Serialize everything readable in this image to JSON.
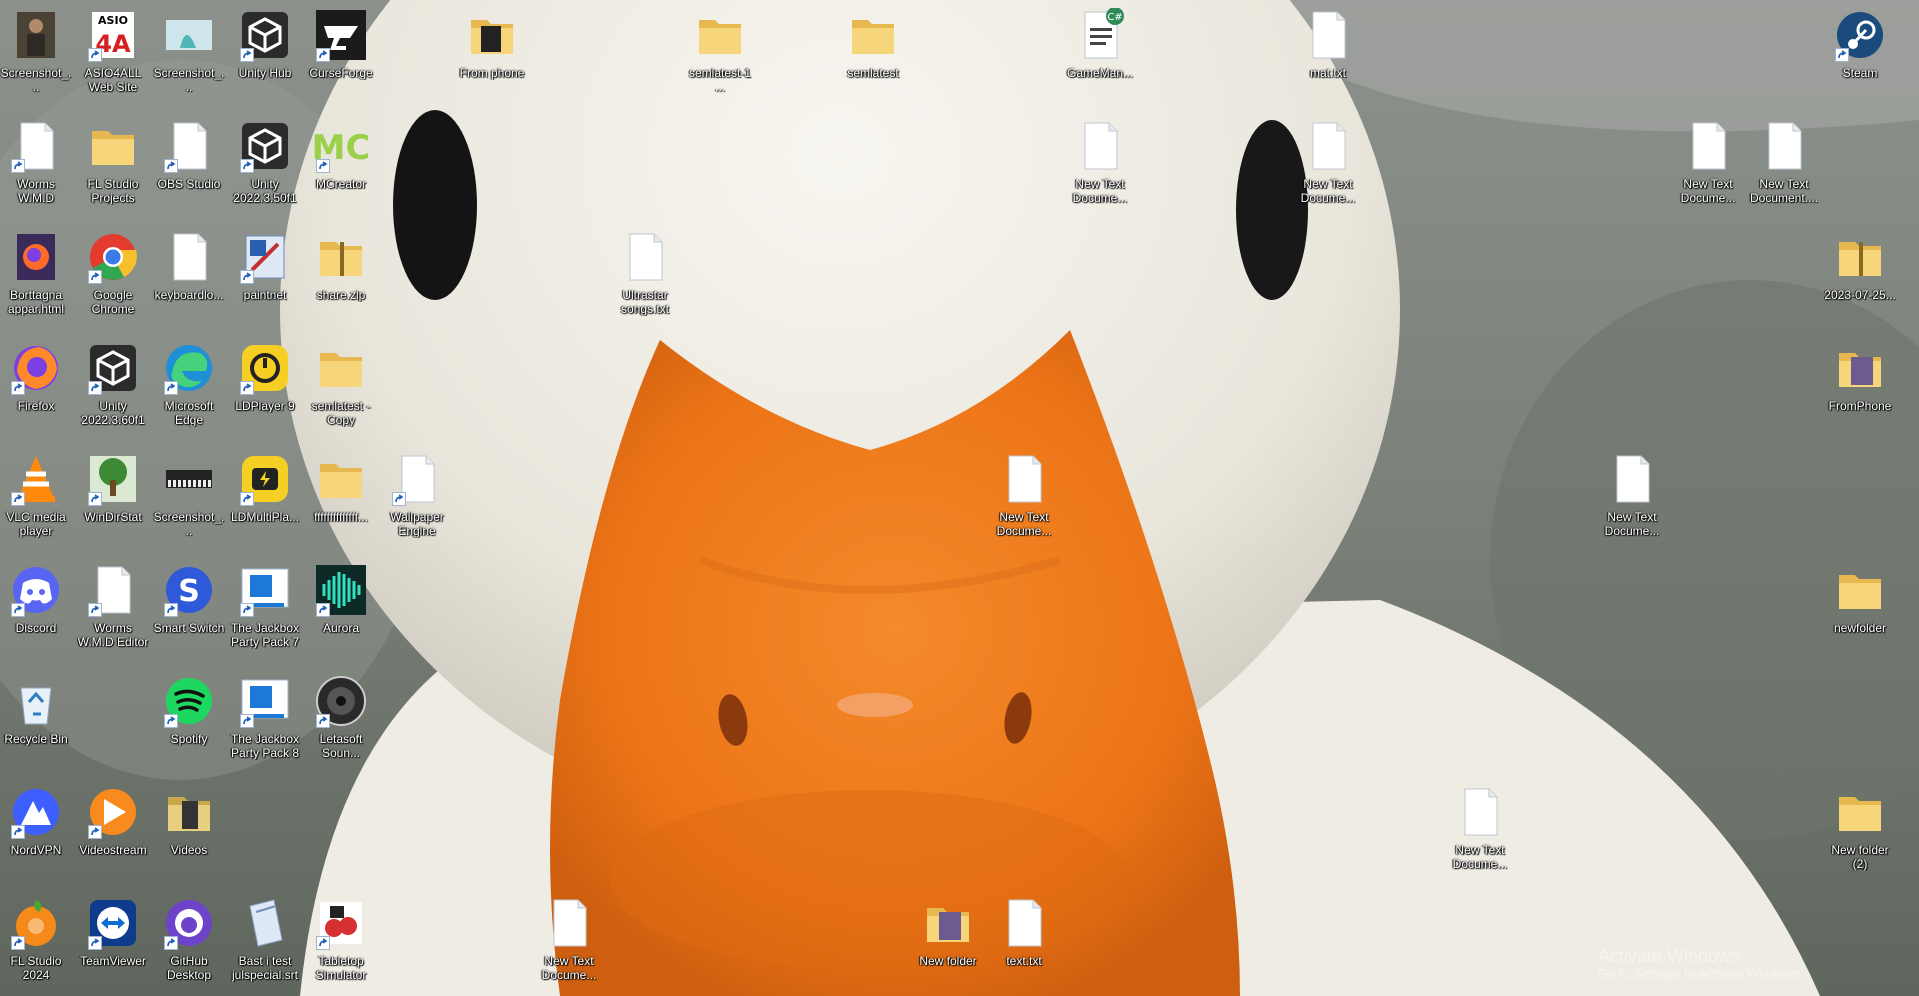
{
  "desktop": {
    "icons": [
      {
        "id": "screenshot-1",
        "label": "Screenshot_...",
        "kind": "photo",
        "shortcut": false
      },
      {
        "id": "asio4all",
        "label": "ASIO4ALL Web Site",
        "kind": "asio",
        "shortcut": true
      },
      {
        "id": "screenshot-2",
        "label": "Screenshot_...",
        "kind": "photo-anime",
        "shortcut": false
      },
      {
        "id": "unity-hub",
        "label": "Unity Hub",
        "kind": "unity",
        "shortcut": true
      },
      {
        "id": "curseforge",
        "label": "CurseForge",
        "kind": "curseforge",
        "shortcut": true
      },
      {
        "id": "from-phone",
        "label": "From phone",
        "kind": "folder-dark",
        "shortcut": false
      },
      {
        "id": "semlatest-1",
        "label": "semlatest-1 ...",
        "kind": "folder",
        "shortcut": false
      },
      {
        "id": "semlatest",
        "label": "semlatest",
        "kind": "folder",
        "shortcut": false
      },
      {
        "id": "gamemanager",
        "label": "GameMan...",
        "kind": "csharp",
        "shortcut": false
      },
      {
        "id": "mat-txt",
        "label": "mat.txt",
        "kind": "text",
        "shortcut": false
      },
      {
        "id": "steam",
        "label": "Steam",
        "kind": "steam",
        "shortcut": true
      },
      {
        "id": "worms-wmd",
        "label": "Worms W.M.D",
        "kind": "blank",
        "shortcut": true
      },
      {
        "id": "fl-studio-projects",
        "label": "FL Studio Projects",
        "kind": "folder",
        "shortcut": false
      },
      {
        "id": "obs-studio",
        "label": "OBS Studio",
        "kind": "blank",
        "shortcut": true
      },
      {
        "id": "unity-2022-3-50f1",
        "label": "Unity 2022.3.50f1",
        "kind": "unity",
        "shortcut": true
      },
      {
        "id": "mcreator",
        "label": "MCreator",
        "kind": "mcreator",
        "shortcut": true
      },
      {
        "id": "new-text-1",
        "label": "New Text Docume...",
        "kind": "text",
        "shortcut": false
      },
      {
        "id": "new-text-2",
        "label": "New Text Docume...",
        "kind": "text",
        "shortcut": false
      },
      {
        "id": "new-text-3",
        "label": "New Text Docume...",
        "kind": "text",
        "shortcut": false
      },
      {
        "id": "new-text-4",
        "label": "New Text Document....",
        "kind": "text",
        "shortcut": false
      },
      {
        "id": "borttagna-appar",
        "label": "Borttagna appar.html",
        "kind": "firefox-doc",
        "shortcut": false
      },
      {
        "id": "google-chrome",
        "label": "Google Chrome",
        "kind": "chrome",
        "shortcut": true
      },
      {
        "id": "keyboardlo",
        "label": "keyboardlo...",
        "kind": "text",
        "shortcut": false
      },
      {
        "id": "paintnet",
        "label": "paintnet",
        "kind": "paintnet",
        "shortcut": true
      },
      {
        "id": "share-zip",
        "label": "share.zip",
        "kind": "zip",
        "shortcut": false
      },
      {
        "id": "ultrastar-songs",
        "label": "Ultrastar songs.txt",
        "kind": "text",
        "shortcut": false
      },
      {
        "id": "date-zip",
        "label": "2023-07-25...",
        "kind": "zip",
        "shortcut": false
      },
      {
        "id": "firefox",
        "label": "Firefox",
        "kind": "firefox",
        "shortcut": true
      },
      {
        "id": "unity-2022-3-60f1",
        "label": "Unity 2022.3.60f1",
        "kind": "unity",
        "shortcut": true
      },
      {
        "id": "microsoft-edge",
        "label": "Microsoft Edge",
        "kind": "edge",
        "shortcut": true
      },
      {
        "id": "ldplayer9",
        "label": "LDPlayer 9",
        "kind": "ldplayer",
        "shortcut": true
      },
      {
        "id": "semlatest-copy",
        "label": "semlatest - Copy",
        "kind": "folder",
        "shortcut": false
      },
      {
        "id": "fromphone",
        "label": "FromPhone",
        "kind": "folder-photo",
        "shortcut": false
      },
      {
        "id": "vlc",
        "label": "VLC media player",
        "kind": "vlc",
        "shortcut": true
      },
      {
        "id": "windirstat",
        "label": "WinDirStat",
        "kind": "tree",
        "shortcut": true
      },
      {
        "id": "screenshot-3",
        "label": "Screenshot_...",
        "kind": "piano",
        "shortcut": false
      },
      {
        "id": "ldmultiplayer",
        "label": "LDMultiPla...",
        "kind": "ldmulti",
        "shortcut": true
      },
      {
        "id": "ffff",
        "label": "ffffffffffffff...",
        "kind": "folder",
        "shortcut": false
      },
      {
        "id": "wallpaper-engine",
        "label": "Wallpaper Engine",
        "kind": "blank",
        "shortcut": true
      },
      {
        "id": "new-text-5",
        "label": "New Text Docume...",
        "kind": "text",
        "shortcut": false
      },
      {
        "id": "new-text-6",
        "label": "New Text Docume...",
        "kind": "text",
        "shortcut": false
      },
      {
        "id": "discord",
        "label": "Discord",
        "kind": "discord",
        "shortcut": true
      },
      {
        "id": "worms-editor",
        "label": "Worms W.M.D Editor",
        "kind": "blank",
        "shortcut": true
      },
      {
        "id": "smart-switch",
        "label": "Smart Switch",
        "kind": "smartswitch",
        "shortcut": true
      },
      {
        "id": "jackbox-7",
        "label": "The Jackbox Party Pack 7",
        "kind": "jackbox",
        "shortcut": true
      },
      {
        "id": "aurora",
        "label": "Aurora",
        "kind": "aurora",
        "shortcut": true
      },
      {
        "id": "newfolder-lower",
        "label": "newfolder",
        "kind": "folder",
        "shortcut": false
      },
      {
        "id": "recycle-bin",
        "label": "Recycle Bin",
        "kind": "recycle",
        "shortcut": false
      },
      {
        "id": "spotify",
        "label": "Spotify",
        "kind": "spotify",
        "shortcut": true
      },
      {
        "id": "jackbox-8",
        "label": "The Jackbox Party Pack 8",
        "kind": "jackbox",
        "shortcut": true
      },
      {
        "id": "letasoft",
        "label": "Letasoft Soun...",
        "kind": "speaker",
        "shortcut": true
      },
      {
        "id": "nordvpn",
        "label": "NordVPN",
        "kind": "nordvpn",
        "shortcut": true
      },
      {
        "id": "videostream",
        "label": "Videostream",
        "kind": "videostream",
        "shortcut": true
      },
      {
        "id": "videos",
        "label": "Videos",
        "kind": "folder-video",
        "shortcut": false
      },
      {
        "id": "new-text-7",
        "label": "New Text Docume...",
        "kind": "text",
        "shortcut": false
      },
      {
        "id": "new-folder-2",
        "label": "New folder (2)",
        "kind": "folder",
        "shortcut": false
      },
      {
        "id": "fl-studio-2024",
        "label": "FL Studio 2024",
        "kind": "flstudio",
        "shortcut": true
      },
      {
        "id": "teamviewer",
        "label": "TeamViewer",
        "kind": "teamviewer",
        "shortcut": true
      },
      {
        "id": "github-desktop",
        "label": "GitHub Desktop",
        "kind": "github",
        "shortcut": true
      },
      {
        "id": "bast-i-test",
        "label": "Bast i test julspecial.srt",
        "kind": "srt",
        "shortcut": false
      },
      {
        "id": "tabletop-simulator",
        "label": "Tabletop Simulator",
        "kind": "tabletop",
        "shortcut": true
      },
      {
        "id": "new-text-8",
        "label": "New Text Docume...",
        "kind": "text",
        "shortcut": false
      },
      {
        "id": "new-folder",
        "label": "New folder",
        "kind": "folder-photo",
        "shortcut": false
      },
      {
        "id": "text-txt",
        "label": "text.txt",
        "kind": "text",
        "shortcut": false
      }
    ]
  },
  "watermark": {
    "line1": "Activate Windows",
    "line2": "Go to Settings to activate Windows."
  },
  "colors": {
    "duck_white": "#f2f0ea",
    "beak_orange": "#f07a1e",
    "water_grey": "#7f847c"
  }
}
